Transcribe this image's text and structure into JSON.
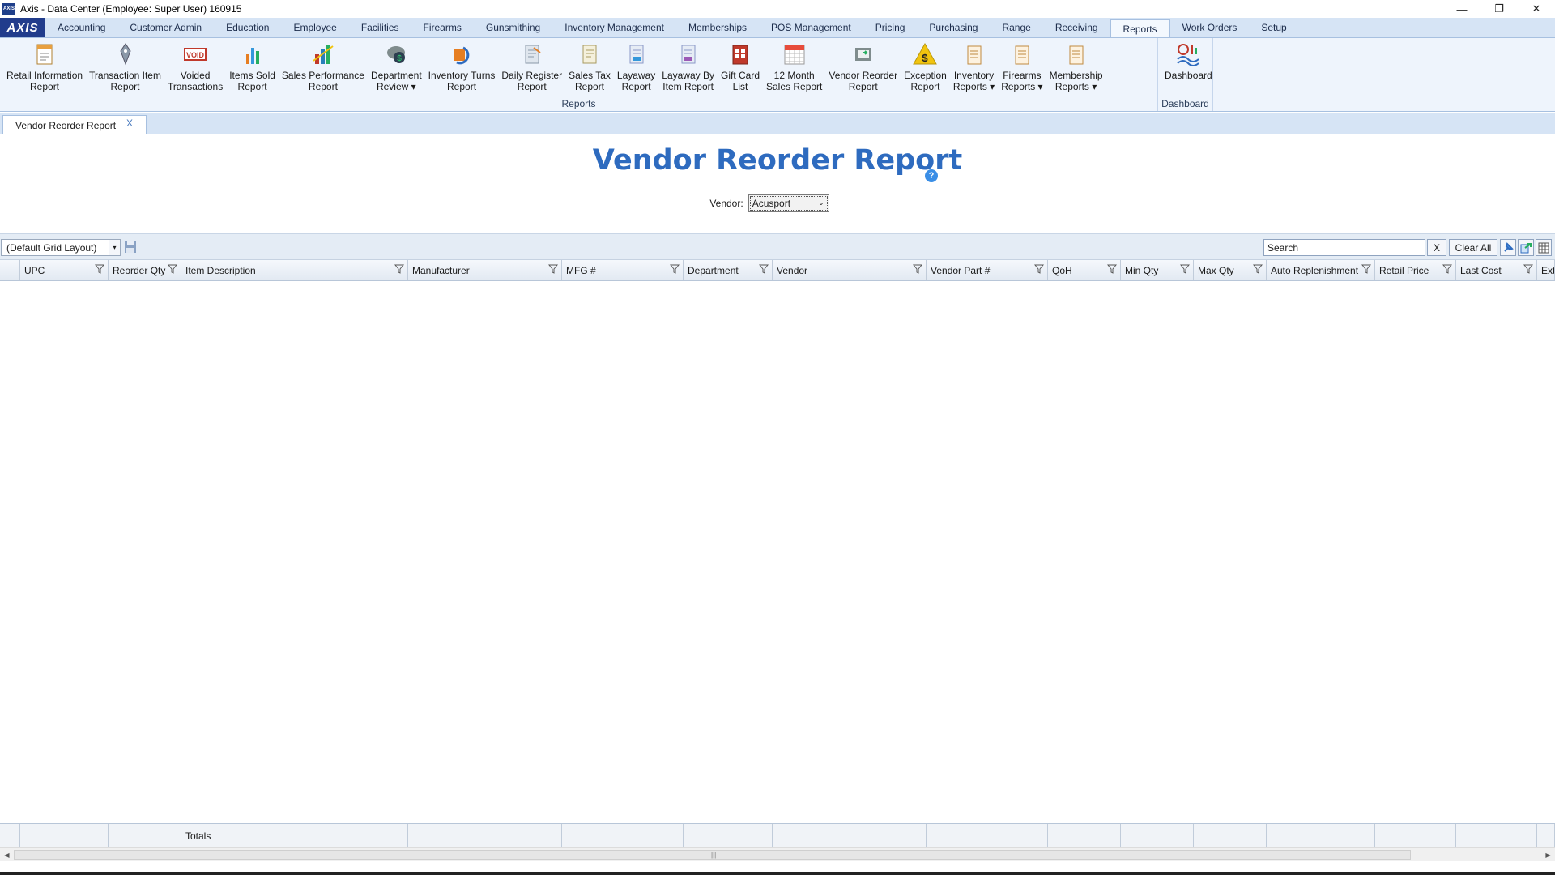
{
  "window": {
    "title": "Axis - Data Center  (Employee: Super User) 160915",
    "minimize": "—",
    "maximize": "❐",
    "close": "✕"
  },
  "logo": "AXIS",
  "tabs": [
    {
      "label": "Accounting"
    },
    {
      "label": "Customer Admin"
    },
    {
      "label": "Education"
    },
    {
      "label": "Employee"
    },
    {
      "label": "Facilities"
    },
    {
      "label": "Firearms"
    },
    {
      "label": "Gunsmithing"
    },
    {
      "label": "Inventory Management"
    },
    {
      "label": "Memberships"
    },
    {
      "label": "POS Management"
    },
    {
      "label": "Pricing"
    },
    {
      "label": "Purchasing"
    },
    {
      "label": "Range"
    },
    {
      "label": "Receiving"
    },
    {
      "label": "Reports",
      "active": true
    },
    {
      "label": "Work Orders"
    },
    {
      "label": "Setup"
    }
  ],
  "ribbon": {
    "reports_group_label": "Reports",
    "dashboard_group_label": "Dashboard",
    "reports": [
      {
        "label": "Retail Information\nReport",
        "icon": "report-doc-icon"
      },
      {
        "label": "Transaction Item\nReport",
        "icon": "pen-icon"
      },
      {
        "label": "Voided\nTransactions",
        "icon": "void-icon"
      },
      {
        "label": "Items Sold\nReport",
        "icon": "bar-chart-icon"
      },
      {
        "label": "Sales Performance\nReport",
        "icon": "sales-chart-icon"
      },
      {
        "label": "Department\nReview ▾",
        "icon": "money-icon"
      },
      {
        "label": "Inventory Turns\nReport",
        "icon": "turns-icon"
      },
      {
        "label": "Daily Register\nReport",
        "icon": "register-icon"
      },
      {
        "label": "Sales Tax\nReport",
        "icon": "tax-icon"
      },
      {
        "label": "Layaway\nReport",
        "icon": "layaway-icon"
      },
      {
        "label": "Layaway By\nItem Report",
        "icon": "layaway-item-icon"
      },
      {
        "label": "Gift Card\nList",
        "icon": "gift-card-icon"
      },
      {
        "label": "12 Month\nSales Report",
        "icon": "calendar-icon"
      },
      {
        "label": "Vendor Reorder\nReport",
        "icon": "reorder-icon"
      },
      {
        "label": "Exception\nReport",
        "icon": "exception-icon"
      },
      {
        "label": "Inventory\nReports ▾",
        "icon": "inventory-icon"
      },
      {
        "label": "Firearms\nReports ▾",
        "icon": "firearms-icon"
      },
      {
        "label": "Membership\nReports ▾",
        "icon": "membership-icon"
      }
    ],
    "dashboard": {
      "label": "Dashboard",
      "icon": "dashboard-icon"
    }
  },
  "doc_tab": {
    "label": "Vendor Reorder Report",
    "close": "X"
  },
  "report": {
    "title": "Vendor Reorder Report",
    "help": "?",
    "vendor_label": "Vendor:",
    "vendor_value": "Acusport"
  },
  "grid_toolbar": {
    "layout": "(Default Grid Layout)",
    "search_value": "Search",
    "search_clear": "X",
    "clear_all": "Clear All"
  },
  "columns": [
    {
      "label": ""
    },
    {
      "label": "UPC"
    },
    {
      "label": "Reorder Qty"
    },
    {
      "label": "Item Description"
    },
    {
      "label": "Manufacturer"
    },
    {
      "label": "MFG #"
    },
    {
      "label": "Department"
    },
    {
      "label": "Vendor"
    },
    {
      "label": "Vendor Part #"
    },
    {
      "label": "QoH"
    },
    {
      "label": "Min Qty"
    },
    {
      "label": "Max Qty"
    },
    {
      "label": "Auto Replenishment"
    },
    {
      "label": "Retail Price"
    },
    {
      "label": "Last Cost"
    },
    {
      "label": "Ext"
    }
  ],
  "totals_label": "Totals",
  "colors": {
    "accent": "#2e6bbf",
    "ribbon_bg": "#eef4fc",
    "tabs_bg": "#d6e4f5",
    "logo_bg": "#213c8c"
  }
}
